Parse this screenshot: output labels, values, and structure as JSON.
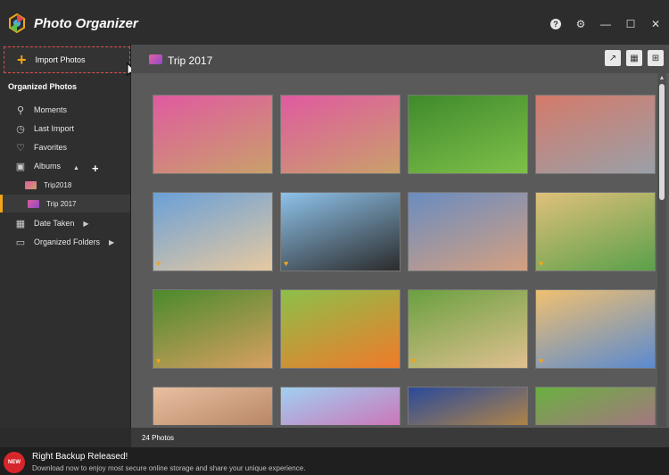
{
  "app": {
    "title": "Photo Organizer"
  },
  "colors": {
    "accent": "#f2a51a",
    "badge": "#d7262b",
    "import_border": "#e05050"
  },
  "titlebar": {
    "icons": [
      "help-icon",
      "settings-icon",
      "minimize-icon",
      "maximize-icon",
      "close-icon"
    ]
  },
  "sidebar": {
    "import_label": "Import Photos",
    "section_title": "Organized Photos",
    "items": [
      {
        "label": "Moments",
        "icon": "moments-icon"
      },
      {
        "label": "Last Import",
        "icon": "clock-icon"
      },
      {
        "label": "Favorites",
        "icon": "heart-icon"
      },
      {
        "label": "Albums",
        "icon": "albums-icon"
      },
      {
        "label": "Trip2018",
        "icon": "album-thumb-icon"
      },
      {
        "label": "Trip 2017",
        "icon": "album-thumb-icon",
        "active": true
      },
      {
        "label": "Date Taken",
        "icon": "calendar-icon"
      },
      {
        "label": "Organized Folders",
        "icon": "folder-icon"
      }
    ]
  },
  "main": {
    "album_title": "Trip 2017",
    "header_actions": [
      "open-external-icon",
      "calendar-view-icon",
      "grid-view-icon"
    ],
    "photos": [
      {
        "fav": false,
        "c1": "#e05aa0",
        "c2": "#c9a06a"
      },
      {
        "fav": false,
        "c1": "#e05aa0",
        "c2": "#c9a06a"
      },
      {
        "fav": false,
        "c1": "#3f8a2c",
        "c2": "#7fc04a"
      },
      {
        "fav": false,
        "c1": "#d47a6a",
        "c2": "#9aa0a8"
      },
      {
        "fav": true,
        "c1": "#6aa0d8",
        "c2": "#e6c9a0"
      },
      {
        "fav": true,
        "c1": "#8ec2ea",
        "c2": "#2b2b2b"
      },
      {
        "fav": false,
        "c1": "#6a8cc0",
        "c2": "#d4a080"
      },
      {
        "fav": true,
        "c1": "#e0c07a",
        "c2": "#5aa04a"
      },
      {
        "fav": true,
        "c1": "#4a8a2c",
        "c2": "#d8a060"
      },
      {
        "fav": false,
        "c1": "#8cc04a",
        "c2": "#f07a2a"
      },
      {
        "fav": true,
        "c1": "#6aa040",
        "c2": "#e0c090"
      },
      {
        "fav": true,
        "c1": "#f0c070",
        "c2": "#5a8ad0"
      },
      {
        "fav": false,
        "c1": "#e8c0a0",
        "c2": "#a06a4a"
      },
      {
        "fav": false,
        "c1": "#a0d0f0",
        "c2": "#e04aa0"
      },
      {
        "fav": false,
        "c1": "#2a4a9a",
        "c2": "#f0a020"
      },
      {
        "fav": false,
        "c1": "#6ab040",
        "c2": "#c05aa0"
      }
    ]
  },
  "status": {
    "count": "24 Photos"
  },
  "promo": {
    "badge": "NEW",
    "title": "Right Backup Released!",
    "text": "Download now to enjoy most secure online storage and share your unique experience."
  }
}
